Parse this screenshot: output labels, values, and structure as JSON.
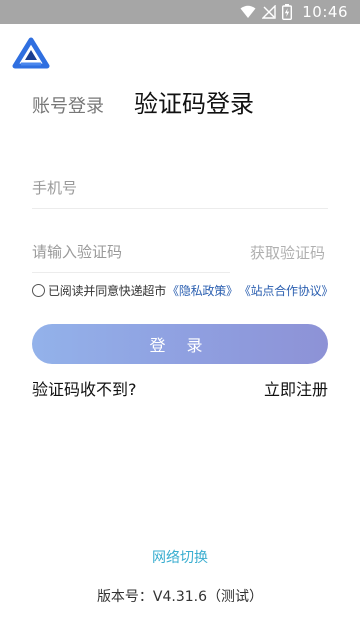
{
  "status_bar": {
    "time": "10:46",
    "icons": [
      "wifi-icon",
      "signal-off-icon",
      "battery-charging-icon"
    ]
  },
  "app": {
    "logo": "app-logo-icon"
  },
  "tabs": {
    "account_login": "账号登录",
    "sms_login": "验证码登录"
  },
  "form": {
    "phone_placeholder": "手机号",
    "code_placeholder": "请输入验证码",
    "get_code_label": "获取验证码"
  },
  "agreement": {
    "text": "已阅读并同意快递超市",
    "privacy_link": "《隐私政策》",
    "site_link": "《站点合作协议》",
    "checked": false
  },
  "actions": {
    "login_label": "登 录",
    "no_code_label": "验证码收不到?",
    "register_label": "立即注册"
  },
  "footer": {
    "network_switch": "网络切换",
    "version": "版本号：V4.31.6（测试）"
  },
  "colors": {
    "status_bar": "#a6a6a6",
    "login_button_start": "#93b2ea",
    "login_button_end": "#8d92d6",
    "link": "#2b5fb0",
    "network_link": "#3aaed0",
    "logo_blue": "#2f6fe0"
  }
}
